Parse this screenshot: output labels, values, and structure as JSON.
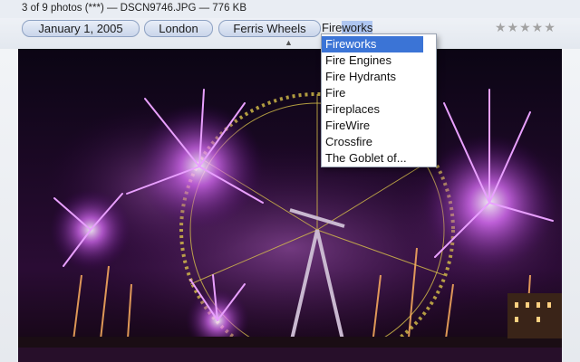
{
  "infobar": {
    "text": "3 of 9 photos (***) — DSCN9746.JPG — 776 KB"
  },
  "tags": [
    {
      "label": "January 1, 2005"
    },
    {
      "label": "London"
    },
    {
      "label": "Ferris Wheels"
    }
  ],
  "tag_input": {
    "value_plain": "Fire",
    "value_selected": "works"
  },
  "rating": {
    "stars": "★★★★★",
    "value": 0,
    "max": 5
  },
  "collapse_icon": "caret-up-icon",
  "dropdown": {
    "items": [
      {
        "label": "Fireworks",
        "selected": true
      },
      {
        "label": "Fire Engines"
      },
      {
        "label": "Fire Hydrants"
      },
      {
        "label": "Fire"
      },
      {
        "label": "Fireplaces"
      },
      {
        "label": "FireWire"
      },
      {
        "label": "Crossfire"
      },
      {
        "label": "The Goblet of..."
      }
    ]
  },
  "colors": {
    "tag_border": "#8ea2c3",
    "selection": "#3b74d6",
    "text_selection": "#aec6f1",
    "fireworks_purple": "#c040e0"
  }
}
